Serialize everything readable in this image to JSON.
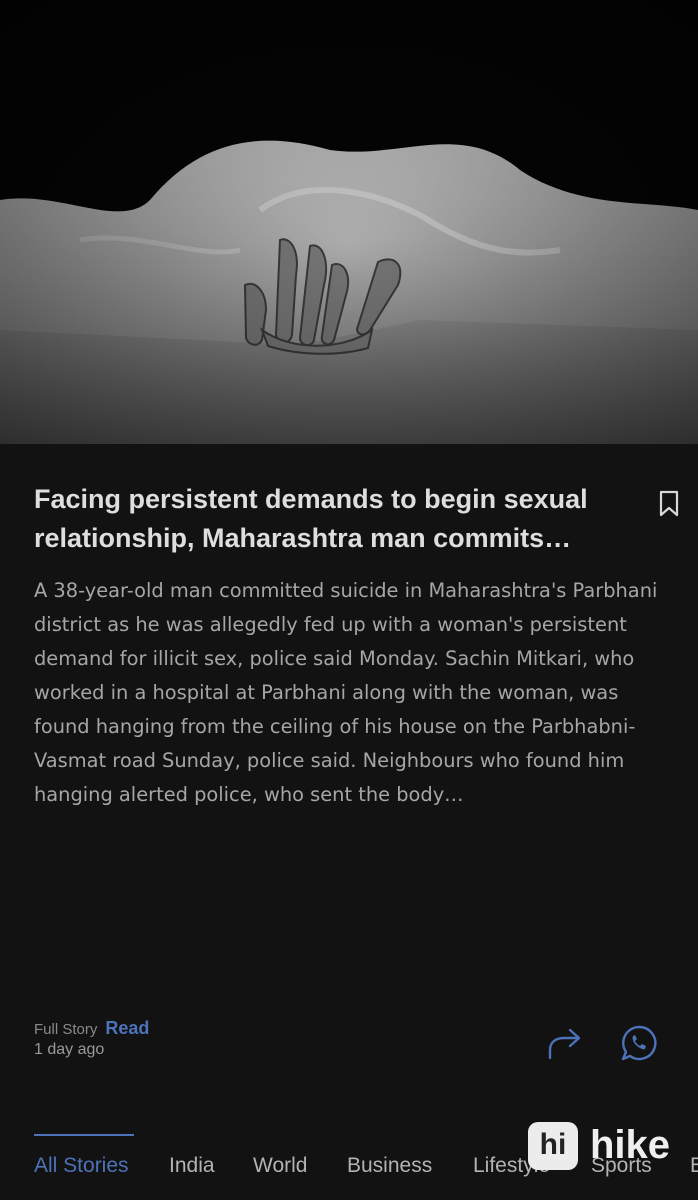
{
  "story": {
    "image_alt": "Black-and-white photo of a hand emerging from under a white sheet on the floor",
    "headline": "Facing persistent demands to begin sexual relationship, Maharashtra man commits…",
    "summary": "A 38-year-old man committed suicide in Maharashtra's Parbhani district as he was allegedly fed up with a woman's persistent demand for illicit sex, police said Monday. Sachin Mitkari, who worked in a hospital at Parbhani along with the woman, was found hanging from the ceiling of his house on the Parbhabni-Vasmat road Sunday, police said. Neighbours who found him hanging alerted police, who sent the body…",
    "full_story_label": "Full Story",
    "read_label": "Read",
    "time_ago": "1 day ago"
  },
  "icons": {
    "bookmark": "bookmark-icon",
    "share": "share-arrow-icon",
    "whatsapp": "whatsapp-icon"
  },
  "tabs": [
    {
      "label": "All Stories",
      "active": true
    },
    {
      "label": "India",
      "active": false
    },
    {
      "label": "World",
      "active": false
    },
    {
      "label": "Business",
      "active": false
    },
    {
      "label": "Lifestyle",
      "active": false
    },
    {
      "label": "Sports",
      "active": false
    },
    {
      "label": "E",
      "active": false
    }
  ],
  "watermark": {
    "badge": "hi",
    "text": "hike"
  },
  "colors": {
    "background": "#121212",
    "accent": "#4d72b8",
    "headline": "#dedede",
    "body_text": "#a6a6a6"
  }
}
